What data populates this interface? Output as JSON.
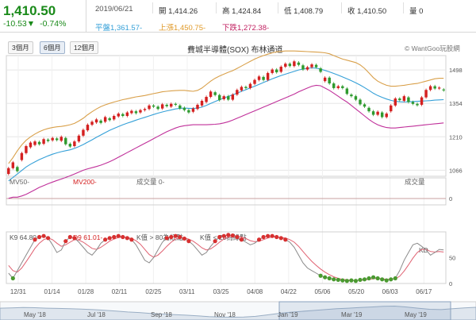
{
  "header": {
    "price": "1,410.50",
    "change": "-10.53▼",
    "change_pct": "-0.74%",
    "date": "2019/06/21",
    "open_label": "開",
    "open": "1,414.26",
    "high_label": "高",
    "high": "1,424.84",
    "low_label": "低",
    "low": "1,408.79",
    "close_label": "收",
    "close": "1,410.50",
    "volume_label": "量",
    "volume": "0",
    "mid_label": "平盤",
    "mid": "1,361.57-",
    "upper_label": "上漲",
    "upper": "1,450.75-",
    "lower_label": "下跌",
    "lower": "1,272.38-"
  },
  "toolbar": {
    "periods": [
      "3個月",
      "6個月",
      "12個月"
    ],
    "active_period": "6個月",
    "chart_title": "費城半導體(SOX) 布林通道",
    "watermark": "© WantGoo玩股網"
  },
  "colors": {
    "up": "#d42020",
    "down": "#2e9a2e",
    "upper_band": "#d9a04a",
    "mid_band": "#35a0d8",
    "lower_band": "#c0309a",
    "k_line": "#8a8a8a",
    "d_line": "#e06070",
    "grid": "#e6e6e6",
    "nav_fill": "#dfe6ee",
    "nav_line": "#9aaec4"
  },
  "chart_data": [
    {
      "type": "candlestick",
      "series_labels": {
        "mv50": "MV50-",
        "mv200": "MV200-"
      },
      "y_ticks": [
        1066,
        1210,
        1354,
        1498
      ],
      "ylim": [
        1040,
        1560
      ],
      "x_ticks": [
        "12/31",
        "01/14",
        "01/28",
        "02/11",
        "02/25",
        "03/11",
        "03/25",
        "04/08",
        "04/22",
        "05/06",
        "05/20",
        "06/03",
        "06/17"
      ],
      "candles": [
        {
          "o": 1050,
          "c": 1075
        },
        {
          "o": 1075,
          "c": 1100
        },
        {
          "o": 1080,
          "c": 1062
        },
        {
          "o": 1110,
          "c": 1140
        },
        {
          "o": 1140,
          "c": 1170
        },
        {
          "o": 1165,
          "c": 1185
        },
        {
          "o": 1175,
          "c": 1190
        },
        {
          "o": 1188,
          "c": 1178
        },
        {
          "o": 1180,
          "c": 1200
        },
        {
          "o": 1198,
          "c": 1192
        },
        {
          "o": 1195,
          "c": 1205
        },
        {
          "o": 1203,
          "c": 1196
        },
        {
          "o": 1193,
          "c": 1210
        },
        {
          "o": 1205,
          "c": 1178
        },
        {
          "o": 1180,
          "c": 1168
        },
        {
          "o": 1170,
          "c": 1190
        },
        {
          "o": 1190,
          "c": 1215
        },
        {
          "o": 1215,
          "c": 1240
        },
        {
          "o": 1238,
          "c": 1262
        },
        {
          "o": 1262,
          "c": 1275
        },
        {
          "o": 1272,
          "c": 1285
        },
        {
          "o": 1280,
          "c": 1270
        },
        {
          "o": 1275,
          "c": 1295
        },
        {
          "o": 1290,
          "c": 1282
        },
        {
          "o": 1285,
          "c": 1300
        },
        {
          "o": 1298,
          "c": 1310
        },
        {
          "o": 1308,
          "c": 1300
        },
        {
          "o": 1300,
          "c": 1315
        },
        {
          "o": 1312,
          "c": 1322
        },
        {
          "o": 1320,
          "c": 1312
        },
        {
          "o": 1315,
          "c": 1325
        },
        {
          "o": 1325,
          "c": 1330
        },
        {
          "o": 1330,
          "c": 1345
        },
        {
          "o": 1345,
          "c": 1340
        },
        {
          "o": 1340,
          "c": 1330
        },
        {
          "o": 1332,
          "c": 1350
        },
        {
          "o": 1348,
          "c": 1342
        },
        {
          "o": 1340,
          "c": 1352
        },
        {
          "o": 1352,
          "c": 1348
        },
        {
          "o": 1345,
          "c": 1332
        },
        {
          "o": 1335,
          "c": 1325
        },
        {
          "o": 1325,
          "c": 1315
        },
        {
          "o": 1318,
          "c": 1332
        },
        {
          "o": 1330,
          "c": 1348
        },
        {
          "o": 1345,
          "c": 1365
        },
        {
          "o": 1360,
          "c": 1382
        },
        {
          "o": 1382,
          "c": 1405
        },
        {
          "o": 1402,
          "c": 1390
        },
        {
          "o": 1390,
          "c": 1368
        },
        {
          "o": 1372,
          "c": 1385
        },
        {
          "o": 1385,
          "c": 1370
        },
        {
          "o": 1370,
          "c": 1392
        },
        {
          "o": 1392,
          "c": 1412
        },
        {
          "o": 1410,
          "c": 1425
        },
        {
          "o": 1425,
          "c": 1420
        },
        {
          "o": 1420,
          "c": 1438
        },
        {
          "o": 1438,
          "c": 1455
        },
        {
          "o": 1455,
          "c": 1470
        },
        {
          "o": 1468,
          "c": 1455
        },
        {
          "o": 1455,
          "c": 1485
        },
        {
          "o": 1485,
          "c": 1500
        },
        {
          "o": 1500,
          "c": 1488
        },
        {
          "o": 1490,
          "c": 1512
        },
        {
          "o": 1512,
          "c": 1525
        },
        {
          "o": 1525,
          "c": 1515
        },
        {
          "o": 1515,
          "c": 1535
        },
        {
          "o": 1530,
          "c": 1520
        },
        {
          "o": 1518,
          "c": 1500
        },
        {
          "o": 1500,
          "c": 1510
        },
        {
          "o": 1510,
          "c": 1522
        },
        {
          "o": 1520,
          "c": 1510
        },
        {
          "o": 1505,
          "c": 1490
        },
        {
          "o": 1450,
          "c": 1465
        },
        {
          "o": 1465,
          "c": 1440
        },
        {
          "o": 1440,
          "c": 1420
        },
        {
          "o": 1420,
          "c": 1428
        },
        {
          "o": 1428,
          "c": 1420
        },
        {
          "o": 1418,
          "c": 1395
        },
        {
          "o": 1392,
          "c": 1385
        },
        {
          "o": 1385,
          "c": 1370
        },
        {
          "o": 1370,
          "c": 1350
        },
        {
          "o": 1350,
          "c": 1340
        },
        {
          "o": 1335,
          "c": 1320
        },
        {
          "o": 1320,
          "c": 1305
        },
        {
          "o": 1305,
          "c": 1318
        },
        {
          "o": 1315,
          "c": 1295
        },
        {
          "o": 1295,
          "c": 1310
        },
        {
          "o": 1320,
          "c": 1345
        },
        {
          "o": 1345,
          "c": 1375
        },
        {
          "o": 1375,
          "c": 1368
        },
        {
          "o": 1365,
          "c": 1385
        },
        {
          "o": 1380,
          "c": 1360
        },
        {
          "o": 1360,
          "c": 1352
        },
        {
          "o": 1352,
          "c": 1346
        },
        {
          "o": 1348,
          "c": 1380
        },
        {
          "o": 1380,
          "c": 1412
        },
        {
          "o": 1412,
          "c": 1428
        },
        {
          "o": 1428,
          "c": 1418
        },
        {
          "o": 1418,
          "c": 1422
        },
        {
          "o": 1414,
          "c": 1410
        }
      ],
      "upper_band": [
        1095,
        1120,
        1150,
        1175,
        1195,
        1210,
        1222,
        1232,
        1240,
        1246,
        1250,
        1253,
        1255,
        1258,
        1262,
        1268,
        1278,
        1290,
        1305,
        1318,
        1330,
        1340,
        1348,
        1354,
        1360,
        1365,
        1370,
        1374,
        1378,
        1382,
        1385,
        1388,
        1392,
        1396,
        1400,
        1404,
        1406,
        1408,
        1409,
        1410,
        1410,
        1408,
        1406,
        1410,
        1420,
        1435,
        1450,
        1462,
        1472,
        1480,
        1488,
        1495,
        1505,
        1515,
        1525,
        1535,
        1545,
        1553,
        1560,
        1566,
        1572,
        1576,
        1578,
        1580,
        1580,
        1580,
        1579,
        1578,
        1577,
        1576,
        1575,
        1574,
        1572,
        1568,
        1560,
        1552,
        1545,
        1540,
        1535,
        1530,
        1520,
        1505,
        1485,
        1465,
        1450,
        1440,
        1432,
        1428,
        1428,
        1430,
        1432,
        1435,
        1438,
        1440,
        1445,
        1450,
        1455,
        1460,
        1462,
        1462
      ],
      "mid_band": [
        1020,
        1035,
        1050,
        1065,
        1080,
        1092,
        1102,
        1112,
        1120,
        1128,
        1135,
        1141,
        1146,
        1150,
        1154,
        1160,
        1168,
        1177,
        1187,
        1197,
        1208,
        1218,
        1228,
        1238,
        1246,
        1254,
        1262,
        1269,
        1275,
        1282,
        1288,
        1294,
        1300,
        1306,
        1312,
        1317,
        1322,
        1326,
        1330,
        1333,
        1334,
        1333,
        1332,
        1334,
        1338,
        1345,
        1354,
        1362,
        1370,
        1377,
        1384,
        1391,
        1398,
        1406,
        1413,
        1421,
        1428,
        1436,
        1444,
        1452,
        1460,
        1467,
        1474,
        1480,
        1486,
        1492,
        1498,
        1502,
        1505,
        1507,
        1506,
        1502,
        1496,
        1490,
        1483,
        1476,
        1468,
        1460,
        1452,
        1443,
        1433,
        1422,
        1410,
        1398,
        1388,
        1380,
        1373,
        1367,
        1363,
        1361,
        1360,
        1361,
        1362,
        1363,
        1364,
        1365,
        1366,
        1368,
        1369,
        1370
      ],
      "lower_band": [
        945,
        950,
        950,
        955,
        962,
        972,
        982,
        992,
        1000,
        1008,
        1015,
        1022,
        1028,
        1035,
        1042,
        1050,
        1058,
        1066,
        1072,
        1077,
        1082,
        1088,
        1095,
        1103,
        1112,
        1122,
        1132,
        1142,
        1152,
        1162,
        1172,
        1182,
        1192,
        1202,
        1212,
        1222,
        1232,
        1240,
        1248,
        1254,
        1258,
        1260,
        1262,
        1262,
        1262,
        1262,
        1263,
        1264,
        1266,
        1270,
        1275,
        1282,
        1290,
        1298,
        1306,
        1314,
        1322,
        1330,
        1338,
        1346,
        1354,
        1362,
        1370,
        1378,
        1386,
        1394,
        1404,
        1412,
        1420,
        1428,
        1432,
        1430,
        1420,
        1410,
        1398,
        1385,
        1372,
        1360,
        1345,
        1330,
        1315,
        1300,
        1285,
        1272,
        1262,
        1255,
        1250,
        1248,
        1248,
        1250,
        1252,
        1254,
        1256,
        1258,
        1260,
        1262,
        1264,
        1266,
        1268,
        1270
      ]
    },
    {
      "type": "bar",
      "title": "成交量 0-",
      "secondary_title": "成交量",
      "y_ticks": [
        0
      ],
      "values": []
    },
    {
      "type": "line",
      "labels": {
        "k": "K9 64.80-",
        "d": "D9 61.01-",
        "overbought": "K值 > 80為紅點",
        "oversold": "K值 < 20為綠點"
      },
      "series_label": "KD",
      "y_ticks": [
        0,
        50
      ],
      "ylim": [
        0,
        100
      ],
      "k_values": [
        20,
        10,
        25,
        40,
        55,
        70,
        85,
        90,
        92,
        88,
        75,
        60,
        65,
        82,
        90,
        88,
        80,
        70,
        60,
        55,
        65,
        78,
        85,
        88,
        90,
        92,
        90,
        88,
        85,
        75,
        60,
        45,
        40,
        50,
        65,
        80,
        88,
        90,
        92,
        90,
        87,
        82,
        75,
        65,
        55,
        60,
        72,
        82,
        90,
        92,
        94,
        93,
        90,
        85,
        80,
        75,
        78,
        85,
        90,
        92,
        92,
        90,
        88,
        85,
        80,
        70,
        55,
        40,
        30,
        25,
        20,
        15,
        12,
        10,
        8,
        7,
        6,
        5,
        6,
        5,
        7,
        8,
        10,
        12,
        10,
        8,
        6,
        8,
        10,
        25,
        45,
        60,
        75,
        78,
        72,
        65,
        55,
        60,
        66,
        65
      ],
      "d_values": [
        35,
        25,
        22,
        30,
        42,
        55,
        68,
        78,
        85,
        88,
        85,
        78,
        72,
        75,
        80,
        85,
        84,
        80,
        74,
        68,
        66,
        70,
        76,
        82,
        86,
        89,
        90,
        89,
        87,
        83,
        76,
        66,
        56,
        51,
        55,
        63,
        72,
        80,
        86,
        88,
        88,
        86,
        82,
        76,
        69,
        65,
        67,
        73,
        80,
        86,
        90,
        92,
        92,
        90,
        87,
        83,
        81,
        82,
        85,
        88,
        90,
        90,
        89,
        88,
        85,
        80,
        72,
        62,
        52,
        43,
        35,
        28,
        22,
        17,
        13,
        10,
        8,
        7,
        6,
        6,
        6,
        7,
        8,
        9,
        10,
        9,
        8,
        8,
        9,
        14,
        24,
        36,
        49,
        60,
        66,
        66,
        62,
        61,
        62,
        61
      ]
    },
    {
      "type": "area",
      "x_ticks": [
        "May '18",
        "Jul '18",
        "Sep '18",
        "Nov '18",
        "Jan '19",
        "Mar '19",
        "May '19"
      ],
      "values": [
        1380,
        1390,
        1400,
        1395,
        1380,
        1370,
        1360,
        1350,
        1330,
        1310,
        1280,
        1250,
        1230,
        1200,
        1180,
        1160,
        1140,
        1120,
        1090,
        1080,
        1070,
        1075,
        1100,
        1150,
        1200,
        1240,
        1270,
        1300,
        1330,
        1360,
        1380,
        1400,
        1420,
        1440,
        1450,
        1420,
        1380,
        1340,
        1330,
        1360,
        1390,
        1410
      ]
    }
  ]
}
